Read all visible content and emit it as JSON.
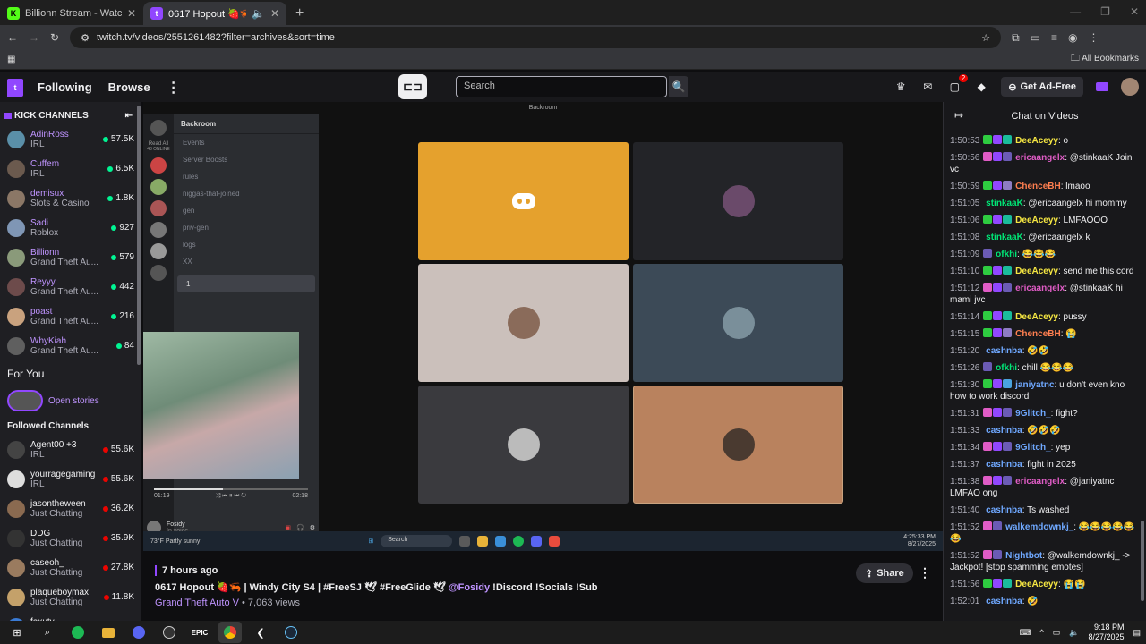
{
  "browser": {
    "tabs": [
      {
        "title": "Billionn Stream - Watch Live on",
        "fav": "K",
        "fav_color": "#53fc18"
      },
      {
        "title": "0617 Hopout 🍓🦐 | Windy",
        "fav": "t",
        "fav_color": "#9147ff"
      }
    ],
    "url": "twitch.tv/videos/2551261482?filter=archives&sort=time",
    "bookmarks_label": "All Bookmarks"
  },
  "nav": {
    "following": "Following",
    "browse": "Browse",
    "search_placeholder": "Search",
    "notif_count": "2",
    "get_ad_free": "Get Ad-Free"
  },
  "sidebar": {
    "kick_header": "KICK CHANNELS",
    "kick_channels": [
      {
        "name": "AdinRoss",
        "category": "IRL",
        "viewers": "57.5K",
        "color": "#5a8fa8"
      },
      {
        "name": "Cuffem",
        "category": "IRL",
        "viewers": "6.5K",
        "color": "#6b5a4e"
      },
      {
        "name": "demisux",
        "category": "Slots & Casino",
        "viewers": "1.8K",
        "color": "#8b7766"
      },
      {
        "name": "Sadi",
        "category": "Roblox",
        "viewers": "927",
        "color": "#7f96b5"
      },
      {
        "name": "Billionn",
        "category": "Grand Theft Au...",
        "viewers": "579",
        "color": "#8a9a7a"
      },
      {
        "name": "Reyyy",
        "category": "Grand Theft Au...",
        "viewers": "442",
        "color": "#6d4b4b"
      },
      {
        "name": "poast",
        "category": "Grand Theft Au...",
        "viewers": "216",
        "color": "#c9a27e"
      },
      {
        "name": "WhyKiah",
        "category": "Grand Theft Au...",
        "viewers": "84",
        "color": "#5f5f5f"
      }
    ],
    "for_you": "For You",
    "open_stories": "Open stories",
    "followed_header": "Followed Channels",
    "followed": [
      {
        "name": "Agent00 +3",
        "category": "IRL",
        "viewers": "55.6K",
        "color": "#444"
      },
      {
        "name": "yourragegaming +3",
        "category": "IRL",
        "viewers": "55.6K",
        "color": "#ddd"
      },
      {
        "name": "jasontheween",
        "category": "Just Chatting",
        "viewers": "36.2K",
        "color": "#8a6a50"
      },
      {
        "name": "DDG",
        "category": "Just Chatting",
        "viewers": "35.9K",
        "color": "#333"
      },
      {
        "name": "caseoh_",
        "category": "Just Chatting",
        "viewers": "27.8K",
        "color": "#9a7b5f"
      },
      {
        "name": "plaqueboymax",
        "category": "Just Chatting",
        "viewers": "11.8K",
        "color": "#c4a16a"
      },
      {
        "name": "faxuty",
        "category": "Fortnite",
        "viewers": "7.2K",
        "color": "#3a7bd5"
      }
    ]
  },
  "video": {
    "window_title": "Backroom",
    "discord": {
      "server": "Backroom",
      "read_all": "Read All",
      "online": "43 ONLINE",
      "channels": [
        "Events",
        "Server Boosts",
        "rules",
        "niggas-that-joined",
        "gen",
        "priv-gen",
        "logs",
        "XX",
        "1"
      ],
      "pip_time_start": "01:19",
      "pip_time_end": "02:18",
      "user": "Fosidy",
      "user_status": "In voice"
    },
    "tiles": [
      {
        "bg": "#e5a12d",
        "kind": "discord"
      },
      {
        "bg": "#232428",
        "kind": "avatar",
        "av": "#6a4a6a"
      },
      {
        "bg": "#cbc0bb",
        "kind": "avatar",
        "av": "#8a6b5a"
      },
      {
        "bg": "#3c4a57",
        "kind": "avatar",
        "av": "#7a8f9a"
      },
      {
        "bg": "#3a3a3e",
        "kind": "avatar",
        "av": "#bbb"
      },
      {
        "bg": "#b9825e",
        "kind": "avatar",
        "av": "#4a3a30"
      }
    ],
    "weather": "73°F",
    "weather_desc": "Partly sunny",
    "win_search": "Search",
    "win_time": "4:25:33 PM",
    "win_date": "8/27/2025"
  },
  "video_info": {
    "ago": "7 hours ago",
    "title_main": "0617 Hopout 🍓🦐 | Windy City S4 | #FreeSJ 🕊 #FreeGlide 🕊 ",
    "title_tag": "@Fosidy",
    "title_end": " !Discord !Socials !Sub",
    "game": "Grand Theft Auto V",
    "views": " • 7,063 views",
    "share": "Share"
  },
  "chat": {
    "header": "Chat on Videos",
    "messages": [
      {
        "ts": "1:50:53",
        "user": "DeeAceyy",
        "color": "#f5e642",
        "text": ": o",
        "badges": [
          "#2ecc40",
          "#9147ff",
          "#1abc9c"
        ]
      },
      {
        "ts": "1:50:56",
        "user": "ericaangelx",
        "color": "#e05cc6",
        "text": ": @stinkaaK Join vc",
        "badges": [
          "#e05cc6",
          "#9147ff",
          "#6b5bb5"
        ]
      },
      {
        "ts": "1:50:59",
        "user": "ChenceBH",
        "color": "#ff7f50",
        "text": ": lmaoo",
        "badges": [
          "#2ecc40",
          "#9147ff",
          "#8e7cc3"
        ]
      },
      {
        "ts": "1:51:05",
        "user": "stinkaaK",
        "color": "#00e676",
        "text": ": @ericaangelx hi mommy",
        "badges": []
      },
      {
        "ts": "1:51:06",
        "user": "DeeAceyy",
        "color": "#f5e642",
        "text": ": LMFAOOO",
        "badges": [
          "#2ecc40",
          "#9147ff",
          "#1abc9c"
        ]
      },
      {
        "ts": "1:51:08",
        "user": "stinkaaK",
        "color": "#00e676",
        "text": ": @ericaangelx k",
        "badges": []
      },
      {
        "ts": "1:51:09",
        "user": "ofkhi",
        "color": "#00e676",
        "text": ": 😂😂😂",
        "badges": [
          "#6b5bb5"
        ]
      },
      {
        "ts": "1:51:10",
        "user": "DeeAceyy",
        "color": "#f5e642",
        "text": ": send me this cord",
        "badges": [
          "#2ecc40",
          "#9147ff",
          "#1abc9c"
        ]
      },
      {
        "ts": "1:51:12",
        "user": "ericaangelx",
        "color": "#e05cc6",
        "text": ": @stinkaaK hi mami jvc",
        "badges": [
          "#e05cc6",
          "#9147ff",
          "#6b5bb5"
        ]
      },
      {
        "ts": "1:51:14",
        "user": "DeeAceyy",
        "color": "#f5e642",
        "text": ": pussy",
        "badges": [
          "#2ecc40",
          "#9147ff",
          "#1abc9c"
        ]
      },
      {
        "ts": "1:51:15",
        "user": "ChenceBH",
        "color": "#ff7f50",
        "text": ": 😭",
        "badges": [
          "#2ecc40",
          "#9147ff",
          "#8e7cc3"
        ]
      },
      {
        "ts": "1:51:20",
        "user": "cashnba",
        "color": "#6fa8ff",
        "text": ": 🤣🤣",
        "badges": []
      },
      {
        "ts": "1:51:26",
        "user": "ofkhi",
        "color": "#00e676",
        "text": ": chill 😂😂😂",
        "badges": [
          "#6b5bb5"
        ]
      },
      {
        "ts": "1:51:30",
        "user": "janiyatnc",
        "color": "#6fa8ff",
        "text": ": u don't even kno how to work discord",
        "badges": [
          "#2ecc40",
          "#9147ff",
          "#4aa3df"
        ]
      },
      {
        "ts": "1:51:31",
        "user": "9Glitch_",
        "color": "#6fa8ff",
        "text": ": fight?",
        "badges": [
          "#e05cc6",
          "#9147ff",
          "#6b5bb5"
        ]
      },
      {
        "ts": "1:51:33",
        "user": "cashnba",
        "color": "#6fa8ff",
        "text": ": 🤣🤣🤣",
        "badges": []
      },
      {
        "ts": "1:51:34",
        "user": "9Glitch_",
        "color": "#6fa8ff",
        "text": ": yep",
        "badges": [
          "#e05cc6",
          "#9147ff",
          "#6b5bb5"
        ]
      },
      {
        "ts": "1:51:37",
        "user": "cashnba",
        "color": "#6fa8ff",
        "text": ": fight in 2025",
        "badges": []
      },
      {
        "ts": "1:51:38",
        "user": "ericaangelx",
        "color": "#e05cc6",
        "text": ": @janiyatnc LMFAO ong",
        "badges": [
          "#e05cc6",
          "#9147ff",
          "#6b5bb5"
        ]
      },
      {
        "ts": "1:51:40",
        "user": "cashnba",
        "color": "#6fa8ff",
        "text": ": Ts washed",
        "badges": []
      },
      {
        "ts": "1:51:52",
        "user": "walkemdownkj_",
        "color": "#6fa8ff",
        "text": ": 😂😂😂😂😂😂",
        "badges": [
          "#e05cc6",
          "#6b5bb5"
        ]
      },
      {
        "ts": "1:51:52",
        "user": "Nightbot",
        "color": "#6fa8ff",
        "text": ": @walkemdownkj_ -> Jackpot! [stop spamming emotes]",
        "badges": [
          "#e05cc6",
          "#6b5bb5"
        ]
      },
      {
        "ts": "1:51:56",
        "user": "DeeAceyy",
        "color": "#f5e642",
        "text": ": 😭😭",
        "badges": [
          "#2ecc40",
          "#9147ff",
          "#1abc9c"
        ]
      },
      {
        "ts": "1:52:01",
        "user": "cashnba",
        "color": "#6fa8ff",
        "text": ": 🤣",
        "badges": []
      }
    ]
  },
  "taskbar": {
    "time": "9:18 PM",
    "date": "8/27/2025"
  }
}
